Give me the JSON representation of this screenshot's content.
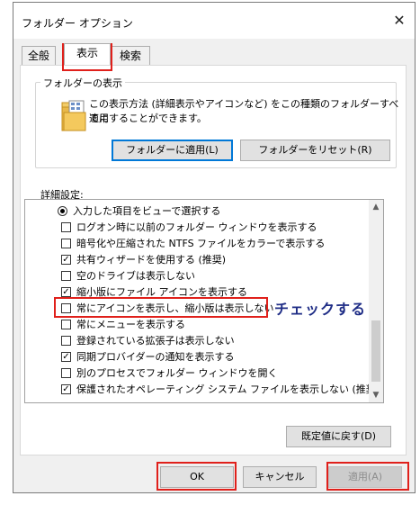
{
  "window": {
    "title": "フォルダー オプション"
  },
  "icons": {
    "close": "close-icon",
    "folder": "folder-icon",
    "scroll_up": "chevron-up-icon",
    "scroll_down": "chevron-down-icon"
  },
  "tabs": [
    {
      "label": "全般",
      "active": false
    },
    {
      "label": "表示",
      "active": true
    },
    {
      "label": "検索",
      "active": false
    }
  ],
  "folder_view": {
    "legend": "フォルダーの表示",
    "description_line1": "この表示方法 (詳細表示やアイコンなど) をこの種類のフォルダーすべてに",
    "description_line2": "適用することができます。",
    "apply_button": "フォルダーに適用(L)",
    "reset_button": "フォルダーをリセット(R)"
  },
  "advanced": {
    "label": "詳細設定:",
    "items": [
      {
        "type": "radio",
        "checked": true,
        "label": "入力した項目をビューで選択する"
      },
      {
        "type": "checkbox",
        "checked": false,
        "label": "ログオン時に以前のフォルダー ウィンドウを表示する"
      },
      {
        "type": "checkbox",
        "checked": false,
        "label": "暗号化や圧縮された NTFS ファイルをカラーで表示する"
      },
      {
        "type": "checkbox",
        "checked": true,
        "label": "共有ウィザードを使用する (推奨)"
      },
      {
        "type": "checkbox",
        "checked": false,
        "label": "空のドライブは表示しない"
      },
      {
        "type": "checkbox",
        "checked": true,
        "label": "縮小版にファイル アイコンを表示する"
      },
      {
        "type": "checkbox",
        "checked": false,
        "label": "常にアイコンを表示し、縮小版は表示しない"
      },
      {
        "type": "checkbox",
        "checked": false,
        "label": "常にメニューを表示する"
      },
      {
        "type": "checkbox",
        "checked": false,
        "label": "登録されている拡張子は表示しない"
      },
      {
        "type": "checkbox",
        "checked": true,
        "label": "同期プロバイダーの通知を表示する"
      },
      {
        "type": "checkbox",
        "checked": false,
        "label": "別のプロセスでフォルダー ウィンドウを開く"
      },
      {
        "type": "checkbox",
        "checked": true,
        "label": "保護されたオペレーティング システム ファイルを表示しない (推奨)"
      }
    ]
  },
  "restore_defaults_button": "既定値に戻す(D)",
  "dialog_buttons": {
    "ok": "OK",
    "cancel": "キャンセル",
    "apply": "適用(A)"
  },
  "annotation": {
    "text": "チェックする",
    "color": "#1f2d86"
  },
  "highlight_color": "#e0201b"
}
